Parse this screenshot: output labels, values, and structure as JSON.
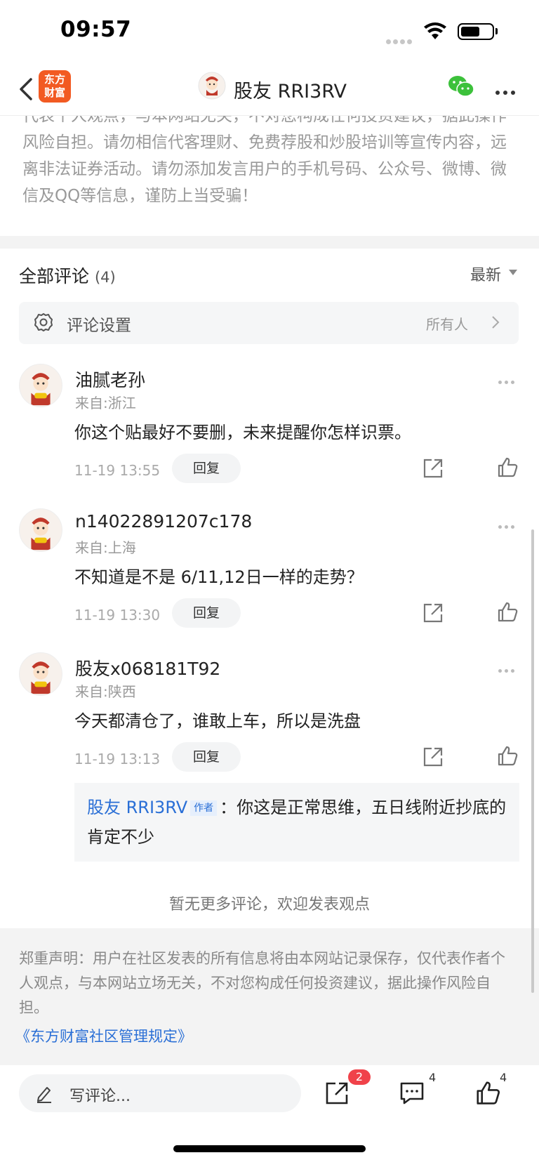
{
  "status_bar": {
    "time": "09:57"
  },
  "nav": {
    "logo_line1": "东方",
    "logo_line2": "财富",
    "title": "股友 RRI3RV"
  },
  "top_disclaimer": "代表个人观点，与本网站无关，不对您构成任何投资建议，据此操作风险自担。请勿相信代客理财、免费荐股和炒股培训等宣传内容，远离非法证券活动。请勿添加发言用户的手机号码、公众号、微博、微信及QQ等信息，谨防上当受骗！",
  "comments_header": {
    "label": "全部评论",
    "count": "(4)",
    "sort": "最新"
  },
  "settings": {
    "label": "评论设置",
    "value": "所有人"
  },
  "comments": [
    {
      "name": "油腻老孙",
      "location": "来自:浙江",
      "text": "你这个贴最好不要删，未来提醒你怎样识票。",
      "time": "11-19 13:55",
      "reply_label": "回复"
    },
    {
      "name": "n14022891207c178",
      "location": "来自:上海",
      "text": "不知道是不是 6/11,12日一样的走势？",
      "time": "11-19 13:30",
      "reply_label": "回复"
    },
    {
      "name": "股友x068181T92",
      "location": "来自:陕西",
      "text": "今天都清仓了，谁敢上车，所以是洗盘",
      "time": "11-19 13:13",
      "reply_label": "回复"
    }
  ],
  "nested_reply": {
    "author": "股友 RRI3RV",
    "tag": "作者",
    "separator": "：",
    "text": "你这是正常思维，五日线附近抄底的肯定不少"
  },
  "no_more": "暂无更多评论，欢迎发表观点",
  "footer": {
    "disclaimer": "郑重声明：用户在社区发表的所有信息将由本网站记录保存，仅代表作者个人观点，与本网站立场无关，不对您构成任何投资建议，据此操作风险自担。",
    "link": "《东方财富社区管理规定》"
  },
  "bottom_bar": {
    "write_placeholder": "写评论...",
    "share_badge": "2",
    "comment_count": "4",
    "like_count": "4"
  },
  "colors": {
    "accent_blue": "#2a6fd6",
    "brand_orange": "#f25a22",
    "badge_red": "#f0424a"
  }
}
